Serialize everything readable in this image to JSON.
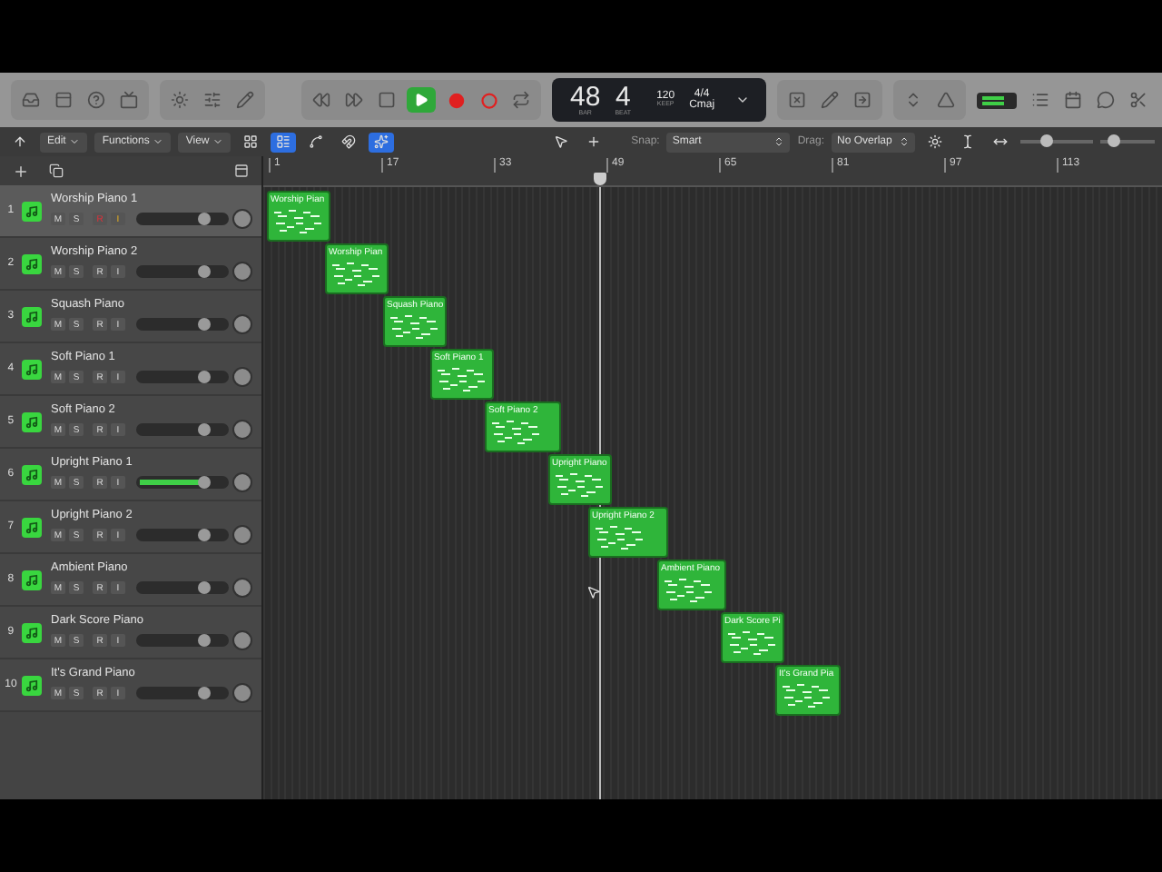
{
  "lcd": {
    "bar": "48",
    "beat": "4",
    "bar_label": "BAR",
    "beat_label": "BEAT",
    "tempo": "120",
    "tempo_mode": "KEEP",
    "signature": "4/4",
    "key": "Cmaj"
  },
  "transport": {
    "playing": true
  },
  "menus": [
    "Edit",
    "Functions",
    "View"
  ],
  "snap": {
    "label": "Snap:",
    "value": "Smart"
  },
  "drag": {
    "label": "Drag:",
    "value": "No Overlap"
  },
  "zoom_sliders": [
    {
      "level": 0.35
    },
    {
      "level": 0.25
    }
  ],
  "ruler": [
    "1",
    "17",
    "33",
    "49",
    "65",
    "81",
    "97",
    "113"
  ],
  "tracks": [
    {
      "number": "1",
      "name": "Worship Piano 1",
      "mute": "M",
      "solo": "S",
      "rec": "R",
      "inp": "I",
      "selected": true,
      "record": true,
      "input": true,
      "level": 0.74,
      "playing": false,
      "region": "Worship Pian"
    },
    {
      "number": "2",
      "name": "Worship Piano 2",
      "mute": "M",
      "solo": "S",
      "rec": "R",
      "inp": "I",
      "selected": false,
      "record": false,
      "input": false,
      "level": 0.74,
      "playing": false,
      "region": "Worship Pian"
    },
    {
      "number": "3",
      "name": "Squash Piano",
      "mute": "M",
      "solo": "S",
      "rec": "R",
      "inp": "I",
      "selected": false,
      "record": false,
      "input": false,
      "level": 0.74,
      "playing": false,
      "region": "Squash Piano"
    },
    {
      "number": "4",
      "name": "Soft Piano 1",
      "mute": "M",
      "solo": "S",
      "rec": "R",
      "inp": "I",
      "selected": false,
      "record": false,
      "input": false,
      "level": 0.74,
      "playing": false,
      "region": "Soft Piano 1"
    },
    {
      "number": "5",
      "name": "Soft Piano 2",
      "mute": "M",
      "solo": "S",
      "rec": "R",
      "inp": "I",
      "selected": false,
      "record": false,
      "input": false,
      "level": 0.74,
      "playing": false,
      "region": "Soft Piano 2"
    },
    {
      "number": "6",
      "name": "Upright Piano 1",
      "mute": "M",
      "solo": "S",
      "rec": "R",
      "inp": "I",
      "selected": false,
      "record": false,
      "input": false,
      "level": 0.74,
      "playing": true,
      "region": "Upright Piano"
    },
    {
      "number": "7",
      "name": "Upright Piano 2",
      "mute": "M",
      "solo": "S",
      "rec": "R",
      "inp": "I",
      "selected": false,
      "record": false,
      "input": false,
      "level": 0.74,
      "playing": false,
      "region": "Upright Piano 2"
    },
    {
      "number": "8",
      "name": "Ambient Piano",
      "mute": "M",
      "solo": "S",
      "rec": "R",
      "inp": "I",
      "selected": false,
      "record": false,
      "input": false,
      "level": 0.74,
      "playing": false,
      "region": "Ambient Piano"
    },
    {
      "number": "9",
      "name": "Dark Score Piano",
      "mute": "M",
      "solo": "S",
      "rec": "R",
      "inp": "I",
      "selected": false,
      "record": false,
      "input": false,
      "level": 0.74,
      "playing": false,
      "region": "Dark Score Pi"
    },
    {
      "number": "10",
      "name": "It's Grand Piano",
      "mute": "M",
      "solo": "S",
      "rec": "R",
      "inp": "I",
      "selected": false,
      "record": false,
      "input": false,
      "level": 0.74,
      "playing": false,
      "region": "It's Grand Pia"
    }
  ]
}
